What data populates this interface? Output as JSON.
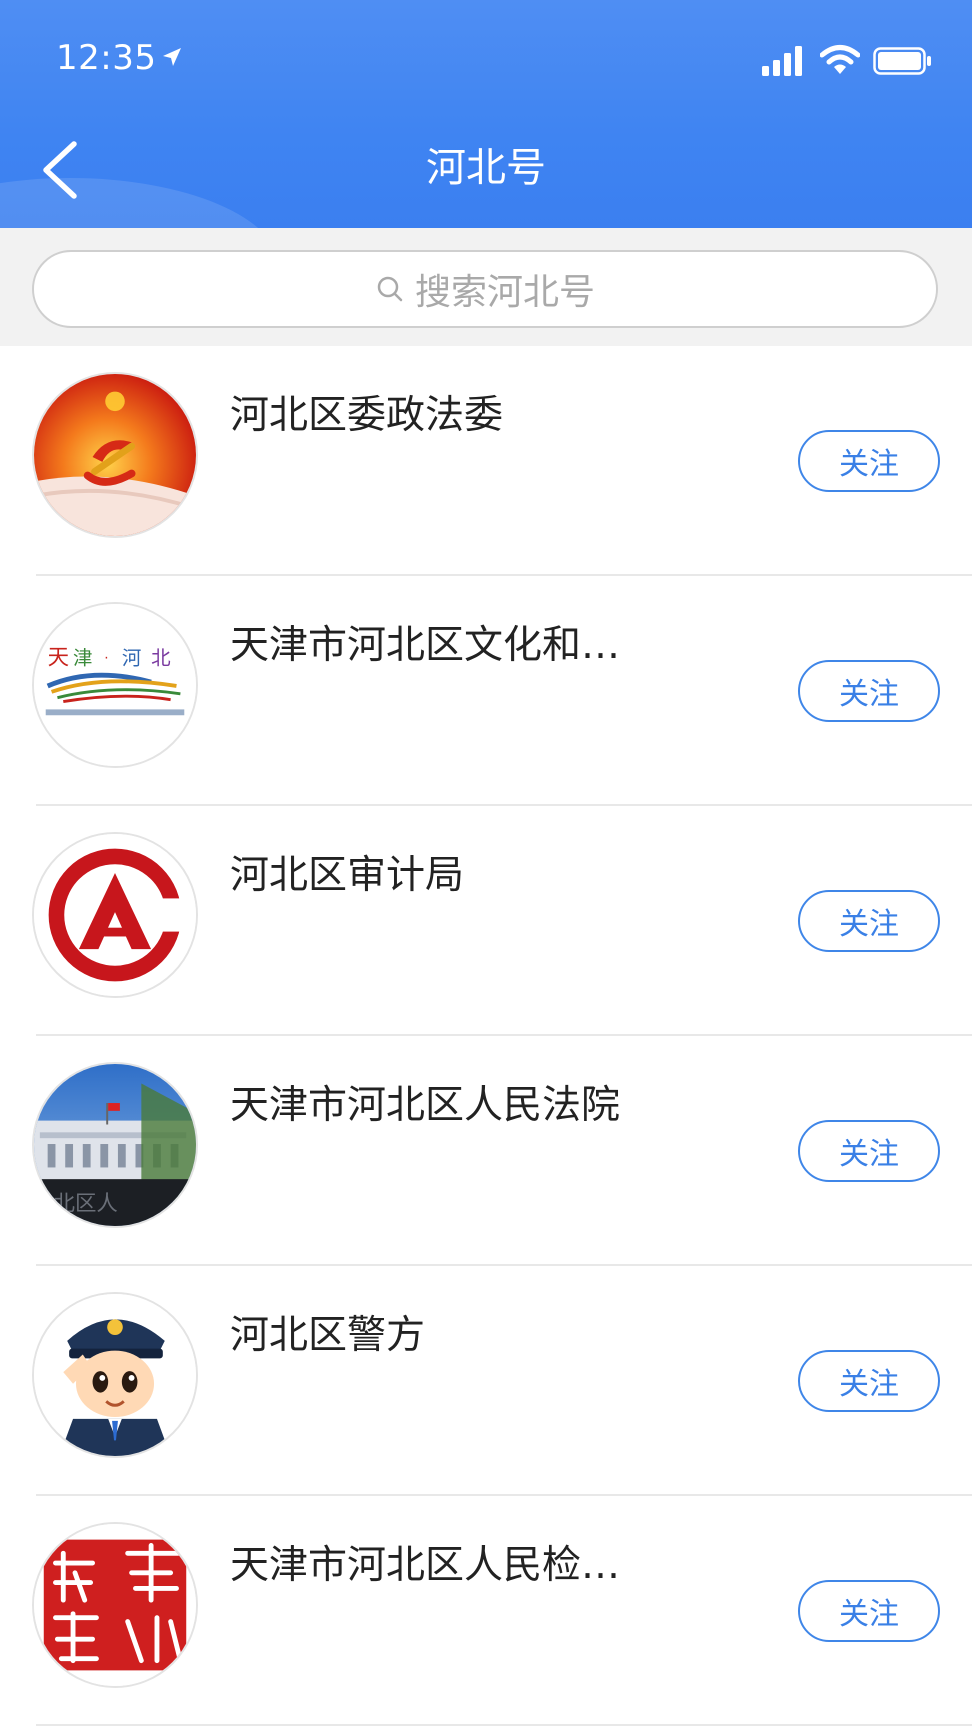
{
  "status_bar": {
    "time": "12:35"
  },
  "header": {
    "title": "河北号",
    "bg_color": "#3f84f2"
  },
  "search": {
    "placeholder": "搜索河北号"
  },
  "list": [
    {
      "title": "河北区委政法委",
      "follow_label": "关注",
      "avatar": "party-emblem"
    },
    {
      "title": "天津市河北区文化和…",
      "follow_label": "关注",
      "avatar": "culture-logo"
    },
    {
      "title": "河北区审计局",
      "follow_label": "关注",
      "avatar": "audit-emblem"
    },
    {
      "title": "天津市河北区人民法院",
      "follow_label": "关注",
      "avatar": "court-building-photo"
    },
    {
      "title": "河北区警方",
      "follow_label": "关注",
      "avatar": "police-cartoon"
    },
    {
      "title": "天津市河北区人民检…",
      "follow_label": "关注",
      "avatar": "procuratorate-seal"
    }
  ],
  "colors": {
    "accent": "#3a80e6",
    "divider": "#e8e8e8",
    "search_bg": "#f2f2f2"
  }
}
